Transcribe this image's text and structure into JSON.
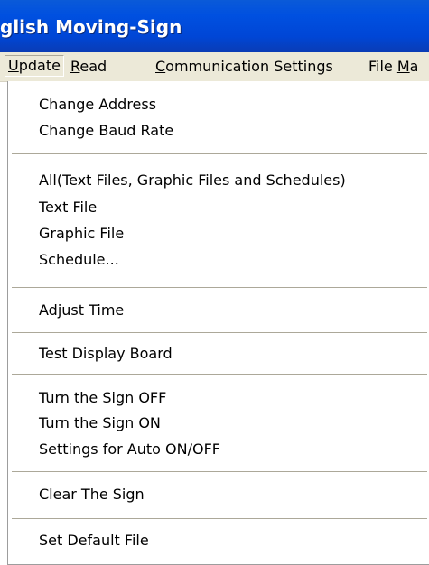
{
  "window": {
    "title": "glish Moving-Sign"
  },
  "menubar": {
    "items": [
      {
        "label_rest": "pdate",
        "mnemonic": "U"
      },
      {
        "label_rest": "ead",
        "mnemonic": "R"
      },
      {
        "label_rest": "ommunication Settings",
        "mnemonic": "C"
      },
      {
        "label_pre": "File ",
        "mnemonic": "M",
        "label_rest": "a"
      }
    ]
  },
  "update_menu": {
    "groups": [
      [
        "Change Address",
        "Change Baud Rate"
      ],
      [
        "All(Text Files, Graphic Files and Schedules)",
        "Text File",
        "Graphic File",
        "Schedule..."
      ],
      [
        "Adjust Time"
      ],
      [
        "Test Display Board"
      ],
      [
        "Turn the Sign OFF",
        "Turn the Sign ON",
        "Settings for Auto ON/OFF"
      ],
      [
        "Clear The Sign"
      ],
      [
        "Set Default File"
      ]
    ]
  }
}
